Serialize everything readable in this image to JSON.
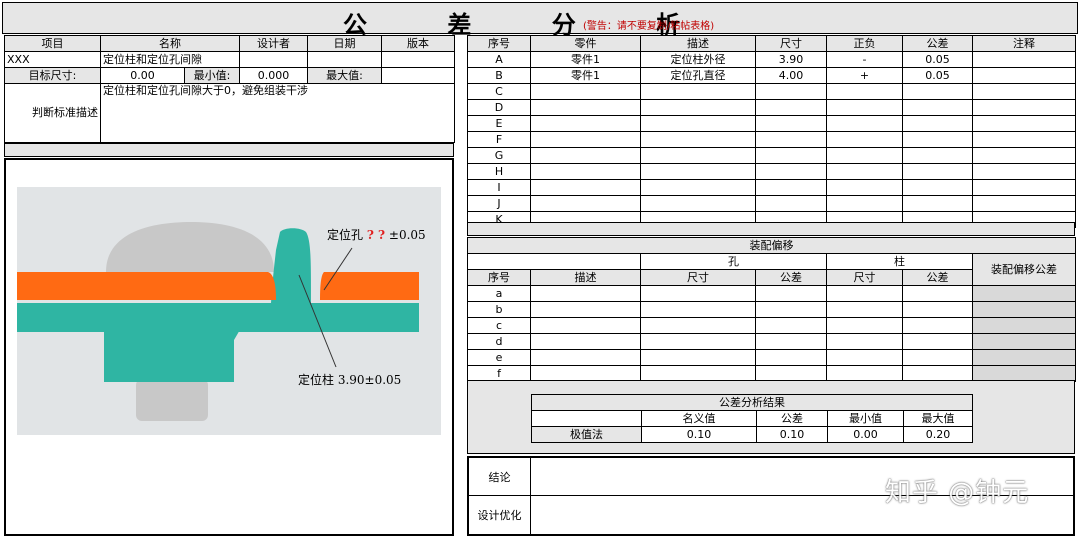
{
  "title": "公 差 分 析",
  "warning": "(警告：请不要复制/粘帖表格)",
  "info": {
    "headers": [
      "项目",
      "名称",
      "设计者",
      "日期",
      "版本"
    ],
    "project": "XXX",
    "name": "定位柱和定位孔间隙",
    "target_label": "目标尺寸:",
    "target_value": "0.00",
    "min_label": "最小值:",
    "min_value": "0.000",
    "max_label": "最大值:",
    "criteria_label": "判断标准描述",
    "criteria_text": "定位柱和定位孔间隙大于0，避免组装干涉"
  },
  "figure": {
    "hole_label": "定位孔",
    "hole_qmarks": "? ?",
    "hole_tol": "±0.05",
    "pin_label": "定位柱 3.90±0.05",
    "colors": {
      "plate_top": "#ff6a13",
      "plate_bottom": "#2fb5a3",
      "screw": "#c8c8c8",
      "background": "#e1e4e6"
    }
  },
  "dims": {
    "headers": [
      "序号",
      "零件",
      "描述",
      "尺寸",
      "正负",
      "公差",
      "注释"
    ],
    "rows": [
      {
        "id": "A",
        "part": "零件1",
        "desc": "定位柱外径",
        "size": "3.90",
        "sign": "-",
        "tol": "0.05",
        "note": ""
      },
      {
        "id": "B",
        "part": "零件1",
        "desc": "定位孔直径",
        "size": "4.00",
        "sign": "+",
        "tol": "0.05",
        "note": ""
      },
      {
        "id": "C",
        "part": "",
        "desc": "",
        "size": "",
        "sign": "",
        "tol": "",
        "note": ""
      },
      {
        "id": "D",
        "part": "",
        "desc": "",
        "size": "",
        "sign": "",
        "tol": "",
        "note": ""
      },
      {
        "id": "E",
        "part": "",
        "desc": "",
        "size": "",
        "sign": "",
        "tol": "",
        "note": ""
      },
      {
        "id": "F",
        "part": "",
        "desc": "",
        "size": "",
        "sign": "",
        "tol": "",
        "note": ""
      },
      {
        "id": "G",
        "part": "",
        "desc": "",
        "size": "",
        "sign": "",
        "tol": "",
        "note": ""
      },
      {
        "id": "H",
        "part": "",
        "desc": "",
        "size": "",
        "sign": "",
        "tol": "",
        "note": ""
      },
      {
        "id": "I",
        "part": "",
        "desc": "",
        "size": "",
        "sign": "",
        "tol": "",
        "note": ""
      },
      {
        "id": "J",
        "part": "",
        "desc": "",
        "size": "",
        "sign": "",
        "tol": "",
        "note": ""
      },
      {
        "id": "K",
        "part": "",
        "desc": "",
        "size": "",
        "sign": "",
        "tol": "",
        "note": ""
      }
    ]
  },
  "offset": {
    "title": "装配偏移",
    "hole": "孔",
    "pin": "柱",
    "tolerance_header": "装配偏移公差",
    "headers": [
      "序号",
      "描述",
      "尺寸",
      "公差",
      "尺寸",
      "公差"
    ],
    "rows": [
      "a",
      "b",
      "c",
      "d",
      "e",
      "f"
    ]
  },
  "result": {
    "title": "公差分析结果",
    "headers": [
      "名义值",
      "公差",
      "最小值",
      "最大值"
    ],
    "method": "极值法",
    "nominal": "0.10",
    "tolerance": "0.10",
    "min": "0.00",
    "max": "0.20"
  },
  "conclusion": {
    "conclusion_label": "结论",
    "optimize_label": "设计优化"
  },
  "watermark": "知乎 @钟元"
}
